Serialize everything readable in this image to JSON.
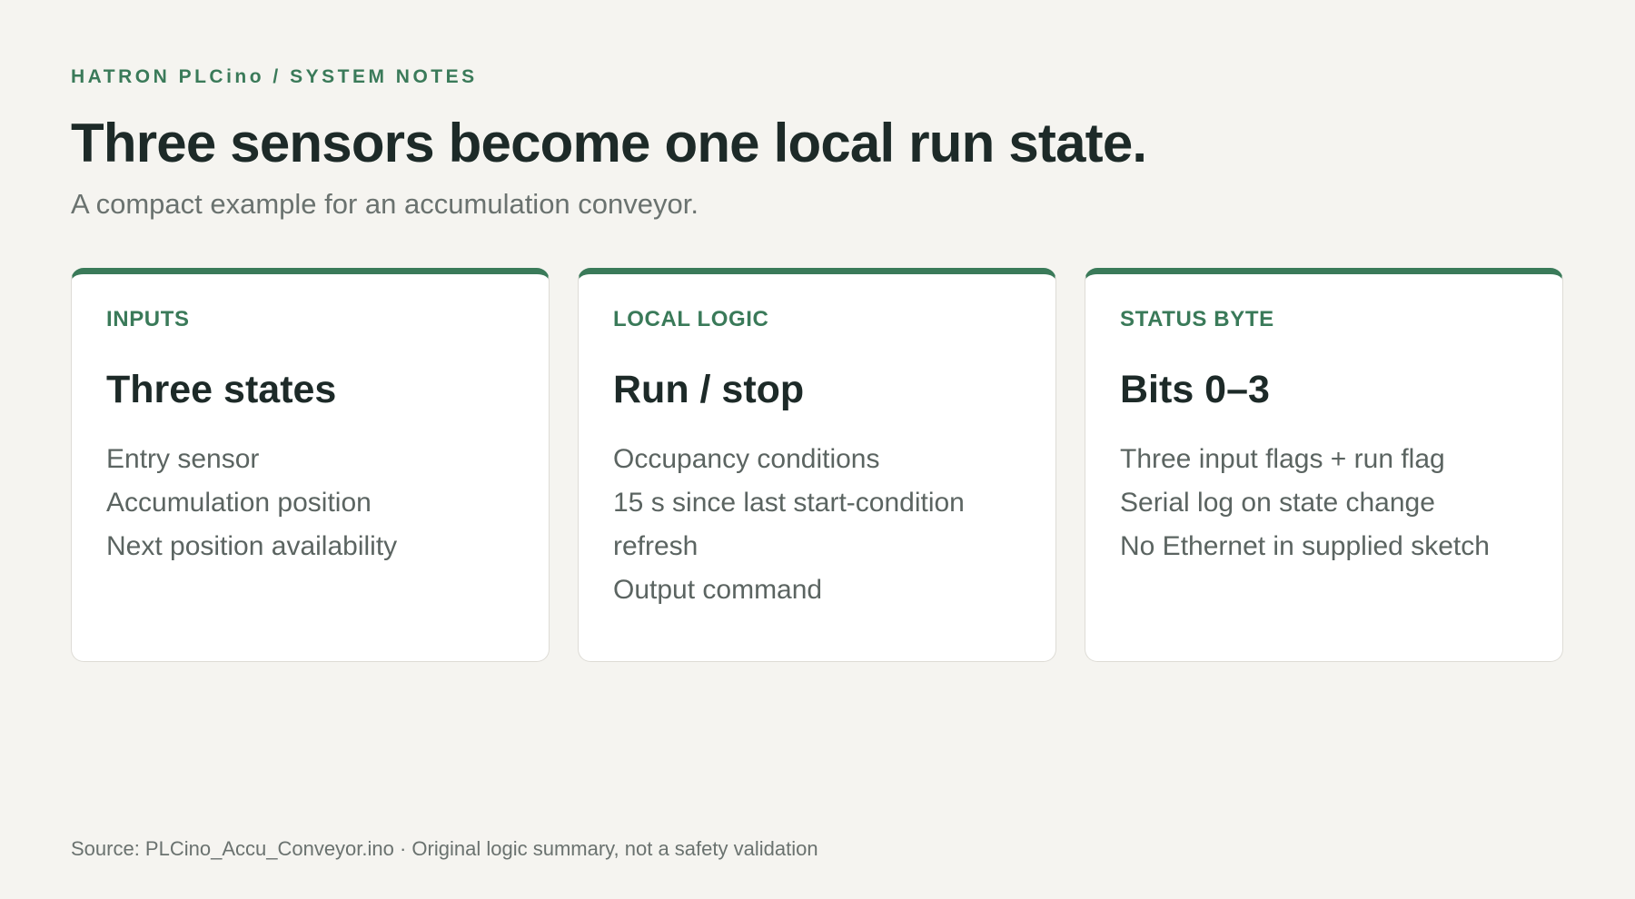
{
  "header": {
    "eyebrow": "HATRON PLCino / SYSTEM NOTES",
    "title": "Three sensors become one local run state.",
    "subtitle": "A compact example for an accumulation conveyor."
  },
  "cards": [
    {
      "kicker": "INPUTS",
      "title": "Three states",
      "items": [
        "Entry sensor",
        "Accumulation position",
        "Next position availability"
      ]
    },
    {
      "kicker": "LOCAL LOGIC",
      "title": "Run / stop",
      "items": [
        "Occupancy conditions",
        "15 s since last start-condition refresh",
        "Output command"
      ]
    },
    {
      "kicker": "STATUS BYTE",
      "title": "Bits 0–3",
      "items": [
        "Three input flags + run flag",
        "Serial log on state change",
        "No Ethernet in supplied sketch"
      ]
    }
  ],
  "footer": {
    "source": "Source: PLCino_Accu_Conveyor.ino · Original logic summary, not a safety validation"
  },
  "colors": {
    "accent": "#3a7a59",
    "background": "#f5f4f0",
    "card": "#ffffff",
    "heading": "#1d2a28",
    "muted": "#6a726f"
  }
}
